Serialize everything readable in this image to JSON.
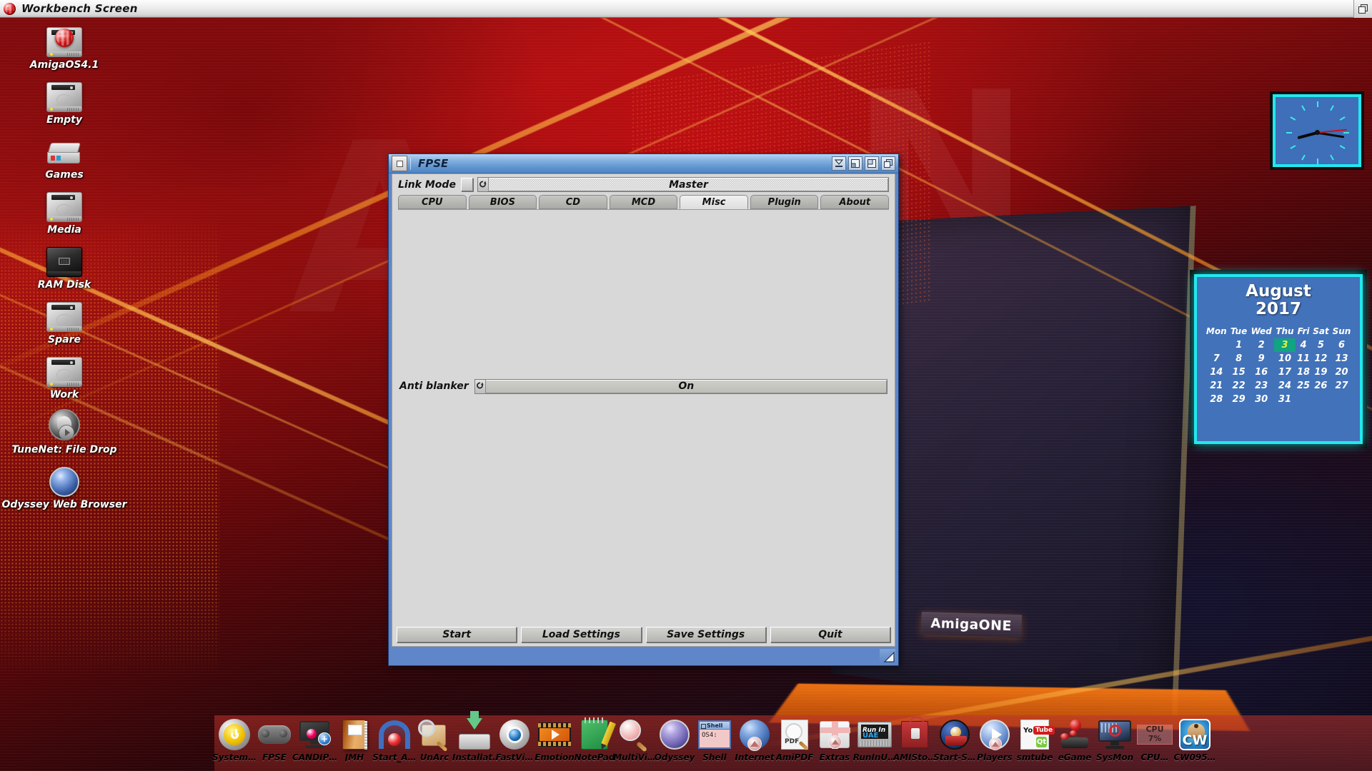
{
  "screen": {
    "title": "Workbench Screen",
    "ball_icon": "amiga-ball-icon",
    "depth_icon": "depth-gadget-icon"
  },
  "desktop_icons": [
    {
      "label": "AmigaOS4.1",
      "icon": "harddisk-amiga-icon"
    },
    {
      "label": "Empty",
      "icon": "harddisk-icon"
    },
    {
      "label": "Games",
      "icon": "cd-drive-icon"
    },
    {
      "label": "Media",
      "icon": "harddisk-icon"
    },
    {
      "label": "RAM Disk",
      "icon": "ramdisk-icon"
    },
    {
      "label": "Spare",
      "icon": "harddisk-icon"
    },
    {
      "label": "Work",
      "icon": "harddisk-icon"
    },
    {
      "label": "TuneNet: File Drop",
      "icon": "speaker-play-icon"
    },
    {
      "label": "Odyssey Web Browser",
      "icon": "blue-orb-icon"
    }
  ],
  "clock": {
    "name": "analog-clock-widget",
    "hour_deg": 255,
    "minute_deg": 99,
    "second_deg": 84,
    "border_color": "#22e8ee",
    "face_color": "#3e6fb8",
    "tick_color": "#3fe7ee",
    "second_hand_color": "#c81414"
  },
  "calendar": {
    "month": "August",
    "year": "2017",
    "title": "August\n2017",
    "weekdays": [
      "Mon",
      "Tue",
      "Wed",
      "Thu",
      "Fri",
      "Sat",
      "Sun"
    ],
    "weeks": [
      [
        "",
        "1",
        "2",
        "3",
        "4",
        "5",
        "6"
      ],
      [
        "7",
        "8",
        "9",
        "10",
        "11",
        "12",
        "13"
      ],
      [
        "14",
        "15",
        "16",
        "17",
        "18",
        "19",
        "20"
      ],
      [
        "21",
        "22",
        "23",
        "24",
        "25",
        "26",
        "27"
      ],
      [
        "28",
        "29",
        "30",
        "31",
        "",
        "",
        ""
      ]
    ],
    "today": "3",
    "today_bg": "#11a382",
    "today_fg": "#ddf73a",
    "border_color": "#22e8ee",
    "face_color": "#4272b9"
  },
  "window": {
    "title": "FPSE",
    "close_icon": "close-gadget-icon",
    "buttons": [
      {
        "name": "iconify-button",
        "icon": "iconify-icon"
      },
      {
        "name": "shrink-button",
        "icon": "shrink-icon"
      },
      {
        "name": "zoom-button",
        "icon": "zoom-icon"
      },
      {
        "name": "depth-button",
        "icon": "depth-icon"
      }
    ],
    "resize_icon": "resize-gadget-icon",
    "link_mode": {
      "label": "Link Mode",
      "checkbox_checked": false,
      "value": "Master",
      "cycle_icon": "cycle-arrow-icon"
    },
    "tabs": [
      {
        "label": "CPU",
        "active": false
      },
      {
        "label": "BIOS",
        "active": false
      },
      {
        "label": "CD",
        "active": false
      },
      {
        "label": "MCD",
        "active": false
      },
      {
        "label": "Misc",
        "active": true
      },
      {
        "label": "Plugin",
        "active": false
      },
      {
        "label": "About",
        "active": false
      }
    ],
    "misc_panel": {
      "anti_blanker": {
        "label": "Anti blanker",
        "value": "On",
        "cycle_icon": "cycle-arrow-icon"
      }
    },
    "actions": [
      {
        "label": "Start"
      },
      {
        "label": "Load Settings"
      },
      {
        "label": "Save Settings"
      },
      {
        "label": "Quit"
      }
    ]
  },
  "dock": {
    "items": [
      {
        "label": "System…",
        "icon": "power-button-icon"
      },
      {
        "label": "FPSE",
        "icon": "gamepad-icon"
      },
      {
        "label": "CANDIP…",
        "icon": "monitor-install-icon"
      },
      {
        "label": "JMH",
        "icon": "book-icon"
      },
      {
        "label": "Start_A…",
        "icon": "amiga-arc-icon"
      },
      {
        "label": "UnArc",
        "icon": "archive-magnifier-icon"
      },
      {
        "label": "Installat…",
        "icon": "install-arrow-icon"
      },
      {
        "label": "FastVi…",
        "icon": "eye-icon"
      },
      {
        "label": "Emotion",
        "icon": "film-strip-icon"
      },
      {
        "label": "NotePad",
        "icon": "notepad-pencil-icon"
      },
      {
        "label": "MultiVi…",
        "icon": "magnifier-icon"
      },
      {
        "label": "Odyssey",
        "icon": "purple-orb-icon"
      },
      {
        "label": "Shell",
        "icon": "shell-window-icon"
      },
      {
        "label": "Internet",
        "icon": "globe-icon"
      },
      {
        "label": "AmiPDF",
        "icon": "pdf-document-icon"
      },
      {
        "label": "Extras",
        "icon": "gift-box-icon"
      },
      {
        "label": "RunInU…",
        "icon": "runinuae-icon"
      },
      {
        "label": "AMISto…",
        "icon": "shopping-bag-icon"
      },
      {
        "label": "Start-S…",
        "icon": "arcade-icon"
      },
      {
        "label": "Players",
        "icon": "media-play-icon"
      },
      {
        "label": "smtube",
        "icon": "youtube-qt-icon"
      },
      {
        "label": "eGame",
        "icon": "joystick-icon"
      },
      {
        "label": "SysMon",
        "icon": "system-monitor-icon"
      },
      {
        "label": "CPU…",
        "icon": "cpu-meter-icon"
      },
      {
        "label": "CW095…",
        "icon": "cupcake-cw-icon"
      }
    ],
    "cpu_meter": {
      "title": "CPU",
      "value": "7%"
    },
    "shell_window": {
      "title": "Shell",
      "content": "OS4:"
    },
    "youtube": {
      "you": "You",
      "tube": "Tube",
      "qt": "Qt"
    },
    "uae": {
      "run_in": "Run In",
      "uae": "UAE"
    },
    "cw": {
      "text": "CW"
    }
  },
  "background": {
    "ghost_a": "A",
    "ghost_n": "N",
    "amiga_badge": "AmigaONE"
  }
}
